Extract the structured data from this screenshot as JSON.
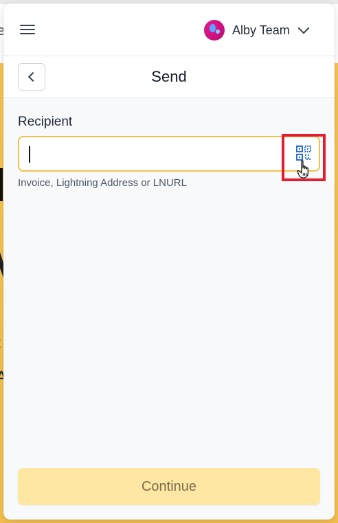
{
  "topbar": {
    "account_name": "Alby Team"
  },
  "header": {
    "title": "Send"
  },
  "form": {
    "recipient_label": "Recipient",
    "recipient_value": "",
    "recipient_hint": "Invoice, Lightning Address or LNURL"
  },
  "actions": {
    "continue_label": "Continue"
  },
  "colors": {
    "accent": "#f2c14c",
    "continue_bg": "#fde7a2",
    "highlight": "#e11d2e",
    "avatar": "#d4127f",
    "qr_icon": "#2b6fd6"
  },
  "icons": [
    "menu-icon",
    "avatar-icon",
    "chevron-down-icon",
    "chevron-left-icon",
    "qr-code-icon",
    "hand-pointer-cursor-icon"
  ]
}
